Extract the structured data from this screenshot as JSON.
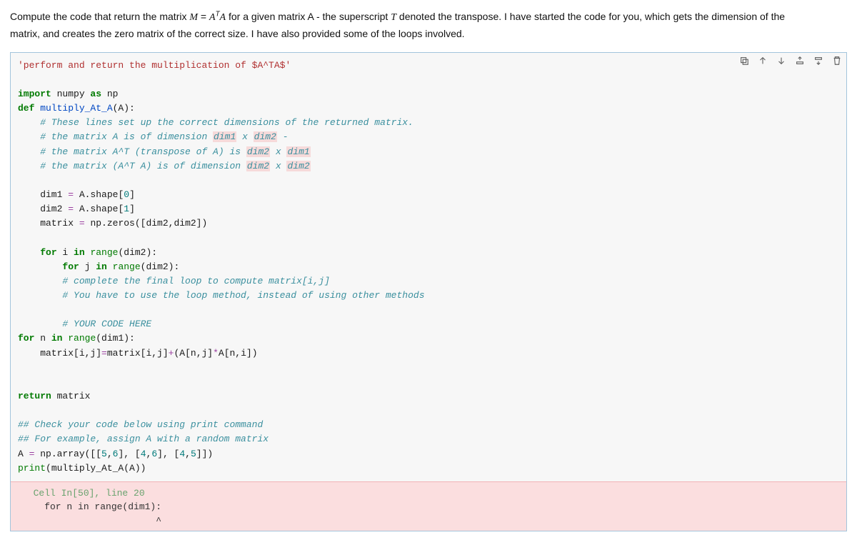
{
  "prompt": {
    "line1_pre": "Compute the code that return the matrix ",
    "eq_M": "M",
    "eq_eqs": " = ",
    "eq_A": "A",
    "eq_T": "T",
    "eq_A2": "A",
    "line1_mid": " for a given matrix A - the superscript ",
    "eq_T2": "T",
    "line1_post": " denoted the transpose. I have started the code for you, which gets the dimension of the",
    "line2": "matrix, and creates the zero matrix of the correct size. I have also provided some of the loops involved."
  },
  "code": {
    "l01_str": "'perform and return the multiplication of $A^TA$'",
    "l03_import": "import",
    "l03_mod": " numpy ",
    "l03_as": "as",
    "l03_alias": " np",
    "l04_def": "def",
    "l04_name": " multiply_At_A",
    "l04_sig": "(A):",
    "l05": "    # These lines set up the correct dimensions of the returned matrix.",
    "l06_a": "    # the matrix A is of dimension ",
    "l06_b": "dim1",
    "l06_c": " x ",
    "l06_d": "dim2",
    "l06_e": " -",
    "l07_a": "    # the matrix A^T (transpose of A) is ",
    "l07_b": "dim2",
    "l07_c": " x ",
    "l07_d": "dim1",
    "l08_a": "    # the matrix (A^T A) is of dimension ",
    "l08_b": "dim2",
    "l08_c": " x ",
    "l08_d": "dim2",
    "l10": "    dim1 ",
    "l10_op": "=",
    "l10_r": " A.shape[",
    "l10_n": "0",
    "l10_r2": "]",
    "l11": "    dim2 ",
    "l11_op": "=",
    "l11_r": " A.shape[",
    "l11_n": "1",
    "l11_r2": "]",
    "l12": "    matrix ",
    "l12_op": "=",
    "l12_r": " np.zeros([dim2,dim2])",
    "l14_a": "    ",
    "l14_for": "for",
    "l14_b": " i ",
    "l14_in": "in",
    "l14_c": " ",
    "l14_range": "range",
    "l14_d": "(dim2):",
    "l15_a": "        ",
    "l15_for": "for",
    "l15_b": " j ",
    "l15_in": "in",
    "l15_c": " ",
    "l15_range": "range",
    "l15_d": "(dim2):",
    "l16": "        # complete the final loop to compute matrix[i,j]",
    "l17": "        # You have to use the loop method, instead of using other methods",
    "l19": "        # YOUR CODE HERE",
    "l20_for": "for",
    "l20_a": " n ",
    "l20_in": "in",
    "l20_b": " ",
    "l20_range": "range",
    "l20_c": "(dim1):",
    "l21_a": "    matrix[i,j]",
    "l21_op": "=",
    "l21_b": "matrix[i,j]",
    "l21_op2": "+",
    "l21_c": "(A[n,j]",
    "l21_op3": "*",
    "l21_d": "A[n,i])",
    "l24_ret": "return",
    "l24_b": " matrix",
    "l26": "## Check your code below using print command",
    "l27": "## For example, assign A with a random matrix",
    "l28_a": "A ",
    "l28_op": "=",
    "l28_b": " np.array([[",
    "l28_n1": "5",
    "l28_c": ",",
    "l28_n2": "6",
    "l28_d": "], [",
    "l28_n3": "4",
    "l28_e": ",",
    "l28_n4": "6",
    "l28_f": "], [",
    "l28_n5": "4",
    "l28_g": ",",
    "l28_n6": "5",
    "l28_h": "]])",
    "l29_print": "print",
    "l29_b": "(multiply_At_A(A))"
  },
  "error": {
    "loc": "  Cell In[50], line 20",
    "code": "    for n in range(dim1):",
    "caret": "                        ^"
  }
}
